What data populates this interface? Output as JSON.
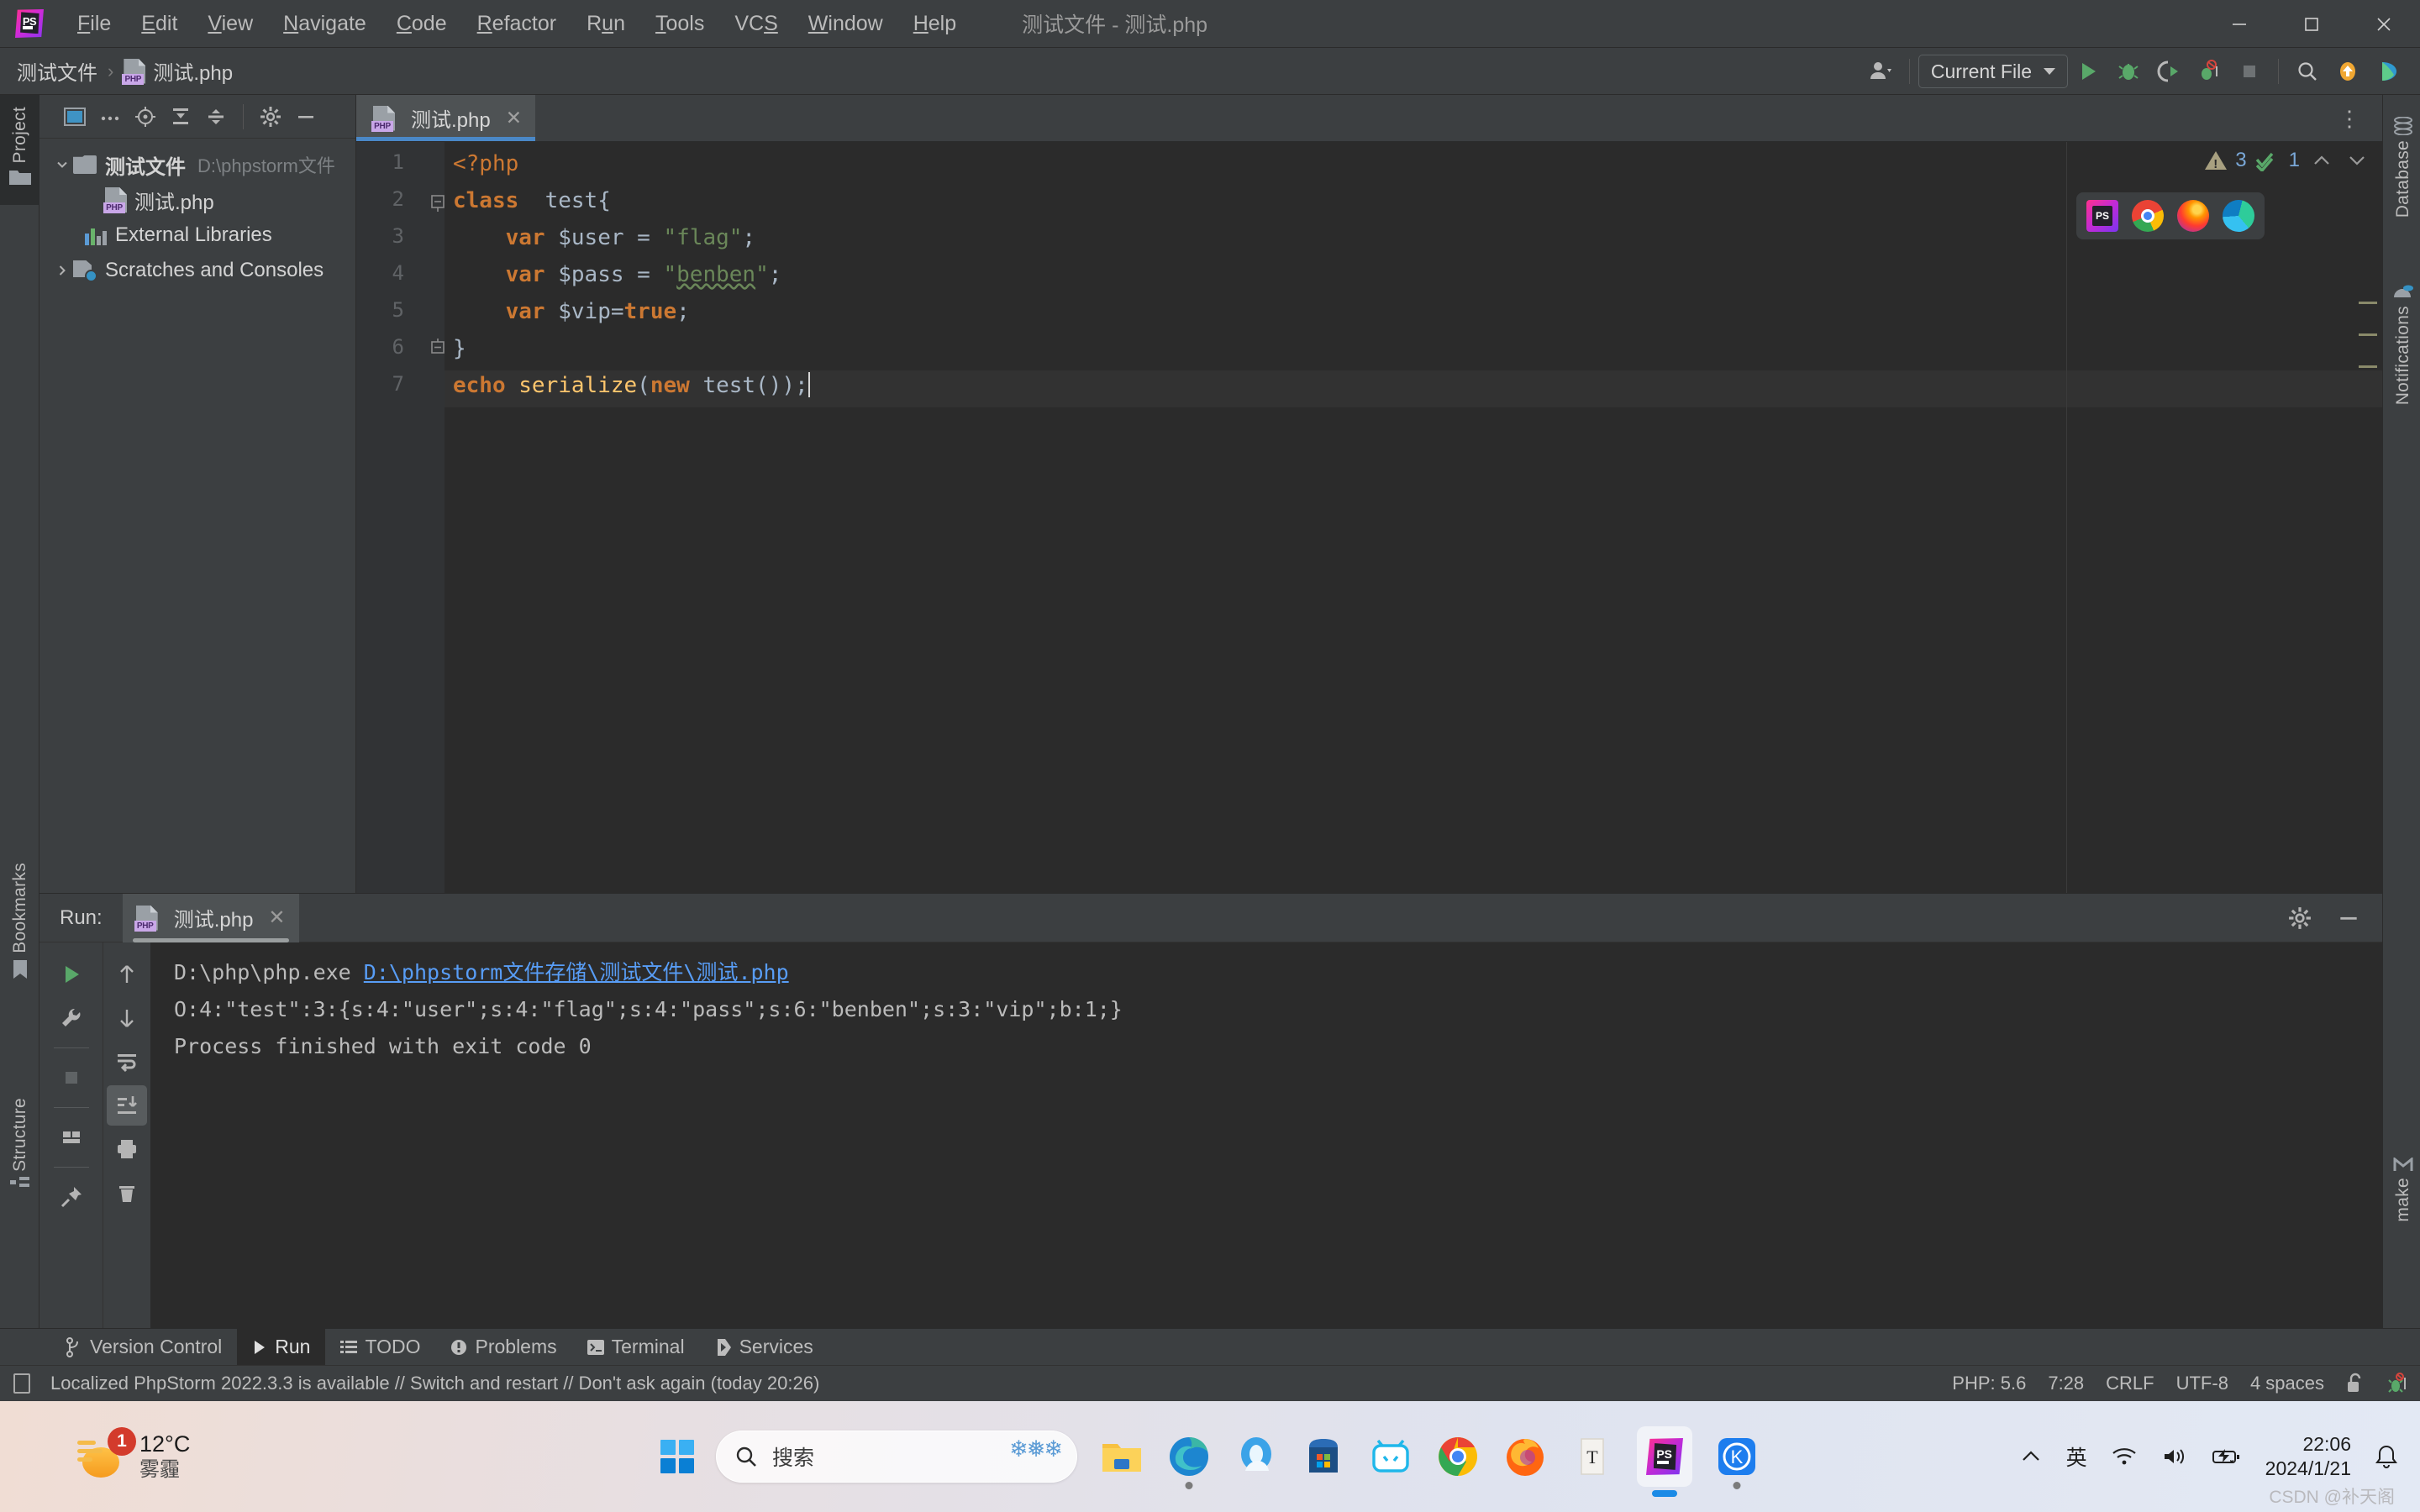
{
  "window": {
    "title": "测试文件 - 测试.php",
    "minimize": "–",
    "maximize": "□",
    "close": "✕"
  },
  "menubar": {
    "items": [
      {
        "label": "File",
        "mnemonic": "F"
      },
      {
        "label": "Edit",
        "mnemonic": "E"
      },
      {
        "label": "View",
        "mnemonic": "V"
      },
      {
        "label": "Navigate",
        "mnemonic": "N"
      },
      {
        "label": "Code",
        "mnemonic": "C"
      },
      {
        "label": "Refactor",
        "mnemonic": "R"
      },
      {
        "label": "Run",
        "mnemonic": "u"
      },
      {
        "label": "Tools",
        "mnemonic": "T"
      },
      {
        "label": "VCS",
        "mnemonic": "S"
      },
      {
        "label": "Window",
        "mnemonic": "W"
      },
      {
        "label": "Help",
        "mnemonic": "H"
      }
    ]
  },
  "navbar": {
    "breadcrumb": {
      "project": "测试文件",
      "separator": "›",
      "file": "测试.php"
    },
    "run_configuration": "Current File",
    "icons": [
      "user-avatar-icon",
      "run-icon",
      "debug-icon",
      "run-with-coverage-icon",
      "profile-icon",
      "stop-icon",
      "search-everywhere-icon",
      "update-project-icon",
      "ide-feature-icon"
    ]
  },
  "left_tool_strip": {
    "tabs": [
      {
        "label": "Project",
        "icon": "folder-icon",
        "active": true
      },
      {
        "label": "Bookmarks",
        "icon": "bookmark-icon",
        "active": false
      },
      {
        "label": "Structure",
        "icon": "structure-icon",
        "active": false
      }
    ]
  },
  "right_tool_strip": {
    "tabs": [
      {
        "label": "Database",
        "icon": "database-icon"
      },
      {
        "label": "Notifications",
        "icon": "notifications-icon"
      },
      {
        "label": "make",
        "icon": "make-icon"
      }
    ]
  },
  "project_panel": {
    "toolbar_icons": [
      "select-opened-file-icon",
      "more-icon",
      "locate-icon",
      "expand-all-icon",
      "collapse-all-icon",
      "settings-icon",
      "hide-icon"
    ],
    "tree": [
      {
        "label": "测试文件",
        "hint": "D:\\phpstorm文件",
        "icon": "folder-icon",
        "arrow": "expanded",
        "indent": 0
      },
      {
        "label": "测试.php",
        "hint": "",
        "icon": "php-file-icon",
        "arrow": "none",
        "indent": 1
      },
      {
        "label": "External Libraries",
        "hint": "",
        "icon": "external-libraries-icon",
        "arrow": "none",
        "indent": 0
      },
      {
        "label": "Scratches and Consoles",
        "hint": "",
        "icon": "scratches-icon",
        "arrow": "collapsed",
        "indent": 0
      }
    ]
  },
  "editor": {
    "tab": {
      "label": "测试.php",
      "icon": "php-file-icon",
      "close": "✕",
      "active": true
    },
    "options_icon": "more-vertical-icon",
    "inspection": {
      "warning_count": "3",
      "ok_count": "1",
      "warning_icon": "warning-triangle-icon",
      "ok_icon": "inspection-ok-icon",
      "prev": "⌃",
      "next": "⌄"
    },
    "browser_popup": [
      "phpstorm-icon",
      "chrome-icon",
      "firefox-icon",
      "edge-icon"
    ],
    "line_numbers": [
      "1",
      "2",
      "3",
      "4",
      "5",
      "6",
      "7"
    ],
    "code_lines": [
      {
        "n": "1",
        "indent": 0,
        "tokens": [
          {
            "t": "<?php",
            "c": "tok-kw"
          }
        ]
      },
      {
        "n": "2",
        "indent": 0,
        "fold": "minus",
        "tokens": [
          {
            "t": "class",
            "c": "tok-kw-b"
          },
          {
            "t": "  ",
            "c": "tok-def"
          },
          {
            "t": "test",
            "c": "tok-cls"
          },
          {
            "t": "{",
            "c": "tok-def"
          }
        ]
      },
      {
        "n": "3",
        "indent": 1,
        "tokens": [
          {
            "t": "var",
            "c": "tok-kw-b"
          },
          {
            "t": " ",
            "c": "tok-def"
          },
          {
            "t": "$user",
            "c": "tok-var2"
          },
          {
            "t": " = ",
            "c": "tok-def"
          },
          {
            "t": "\"flag\"",
            "c": "tok-str"
          },
          {
            "t": ";",
            "c": "tok-def"
          }
        ]
      },
      {
        "n": "4",
        "indent": 1,
        "tokens": [
          {
            "t": "var",
            "c": "tok-kw-b"
          },
          {
            "t": " ",
            "c": "tok-def"
          },
          {
            "t": "$pass",
            "c": "tok-var2"
          },
          {
            "t": " = ",
            "c": "tok-def"
          },
          {
            "t": "\"",
            "c": "tok-str"
          },
          {
            "t": "benben",
            "c": "tok-str squiggle"
          },
          {
            "t": "\"",
            "c": "tok-str"
          },
          {
            "t": ";",
            "c": "tok-def"
          }
        ]
      },
      {
        "n": "5",
        "indent": 1,
        "tokens": [
          {
            "t": "var",
            "c": "tok-kw-b"
          },
          {
            "t": " ",
            "c": "tok-def"
          },
          {
            "t": "$vip",
            "c": "tok-var2"
          },
          {
            "t": "=",
            "c": "tok-def"
          },
          {
            "t": "true",
            "c": "tok-kw-b"
          },
          {
            "t": ";",
            "c": "tok-def"
          }
        ]
      },
      {
        "n": "6",
        "indent": 0,
        "fold": "minus-end",
        "tokens": [
          {
            "t": "}",
            "c": "tok-def"
          }
        ]
      },
      {
        "n": "7",
        "indent": 0,
        "current": true,
        "tokens": [
          {
            "t": "echo",
            "c": "tok-kw-b"
          },
          {
            "t": " ",
            "c": "tok-def"
          },
          {
            "t": "serialize",
            "c": "tok-fn"
          },
          {
            "t": "(",
            "c": "tok-def"
          },
          {
            "t": "new",
            "c": "tok-kw-b"
          },
          {
            "t": " ",
            "c": "tok-def"
          },
          {
            "t": "test",
            "c": "tok-def"
          },
          {
            "t": "());",
            "c": "tok-def"
          }
        ]
      }
    ]
  },
  "run_panel": {
    "label": "Run:",
    "tab": {
      "label": "测试.php",
      "icon": "php-run-icon",
      "close": "✕"
    },
    "header_icons": [
      "settings-icon",
      "hide-icon"
    ],
    "toolbar_left": [
      "rerun-icon",
      "wrench-icon",
      "stop-icon",
      "layout-icon",
      "pin-icon"
    ],
    "toolbar_right": [
      "up-icon",
      "down-icon",
      "soft-wrap-icon",
      "scroll-to-end-icon",
      "print-icon",
      "clear-all-icon"
    ],
    "console": {
      "command": "D:\\php\\php.exe ",
      "link": "D:\\phpstorm文件存储\\测试文件\\测试.php",
      "output": "O:4:\"test\":3:{s:4:\"user\";s:4:\"flag\";s:4:\"pass\";s:6:\"benben\";s:3:\"vip\";b:1;}",
      "exit": "Process finished with exit code 0"
    }
  },
  "bottom_tabs": [
    {
      "label": "Version Control",
      "icon": "vcs-icon",
      "active": false
    },
    {
      "label": "Run",
      "icon": "run-icon",
      "active": true
    },
    {
      "label": "TODO",
      "icon": "todo-icon",
      "active": false
    },
    {
      "label": "Problems",
      "icon": "problems-icon",
      "active": false
    },
    {
      "label": "Terminal",
      "icon": "terminal-icon",
      "active": false
    },
    {
      "label": "Services",
      "icon": "services-icon",
      "active": false
    }
  ],
  "statusbar": {
    "message": "Localized PhpStorm 2022.3.3 is available // Switch and restart // Don't ask again (today 20:26)",
    "php_version": "PHP: 5.6",
    "caret": "7:28",
    "line_separator": "CRLF",
    "encoding": "UTF-8",
    "indent": "4 spaces",
    "lock_icon": "unlocked-icon",
    "debug_icon": "debug-inactive-icon"
  },
  "taskbar": {
    "weather": {
      "temp": "12°C",
      "desc": "雾霾",
      "badge": "1"
    },
    "search": {
      "placeholder": "搜索",
      "icon": "search-icon",
      "decoration": "snowflake-icon"
    },
    "start": "windows-start-icon",
    "apps": [
      {
        "name": "file-explorer-icon",
        "running": false
      },
      {
        "name": "edge-icon",
        "running": true
      },
      {
        "name": "outlook-icon",
        "running": false
      },
      {
        "name": "microsoft-store-icon",
        "running": false
      },
      {
        "name": "bilibili-icon",
        "running": false
      },
      {
        "name": "chrome-icon",
        "running": false
      },
      {
        "name": "firefox-icon",
        "running": false
      },
      {
        "name": "typora-icon",
        "running": false
      },
      {
        "name": "phpstorm-icon",
        "running": true,
        "active": true
      },
      {
        "name": "kugou-icon",
        "running": true
      }
    ],
    "tray": {
      "overflow": "⌃",
      "ime": "英",
      "wifi": "wifi-icon",
      "volume": "volume-icon",
      "battery": "battery-icon",
      "time": "22:06",
      "date": "2024/1/21",
      "notification": "bell-icon"
    },
    "watermark": "CSDN @补天阁"
  },
  "colors": {
    "ide_bg": "#3c3f41",
    "editor_bg": "#2b2b2b",
    "accent_blue": "#4a88c7",
    "keyword_orange": "#cc7832",
    "string_green": "#6a8759",
    "function_yellow": "#ffc66d",
    "link_blue": "#589df6"
  }
}
